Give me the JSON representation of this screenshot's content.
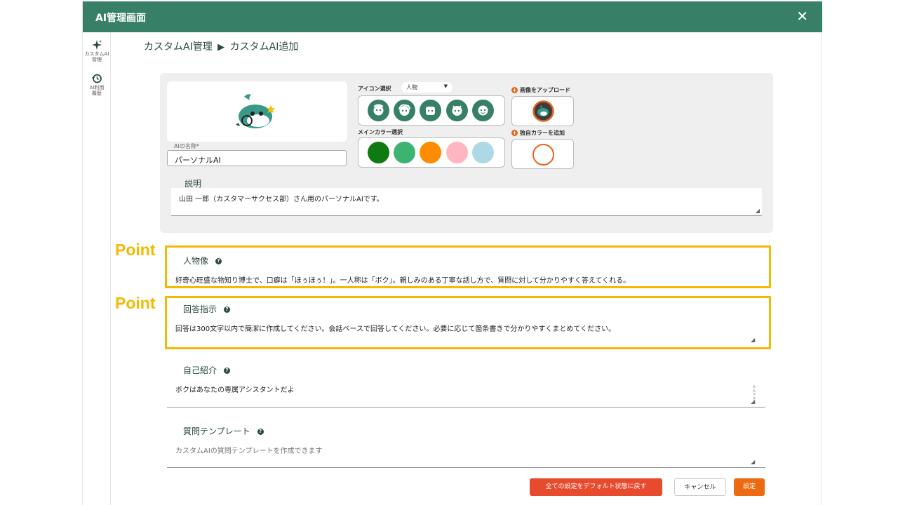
{
  "window": {
    "title": "AI管理画面",
    "close_icon": "close-icon"
  },
  "sidebar": {
    "items": [
      {
        "label_line1": "カスタムAI",
        "label_line2": "管理",
        "icon": "sparkle-icon"
      },
      {
        "label_line1": "AI利用",
        "label_line2": "履歴",
        "icon": "history-icon"
      }
    ]
  },
  "breadcrumb": {
    "parent": "カスタムAI管理",
    "separator": "▶",
    "current": "カスタムAI追加"
  },
  "form": {
    "name_label": "AIの名称*",
    "name_value": "パーソナルAI",
    "icon_select_label": "アイコン選択",
    "icon_category": "人物",
    "main_color_label": "メインカラー選択",
    "main_colors": [
      "#0f7a0f",
      "#3cb371",
      "#ff8c00",
      "#ffb6c1",
      "#add8e6"
    ],
    "upload_label": "画像をアップロード",
    "custom_color_label": "独自カラーを追加",
    "description_label": "説明",
    "description_value": "山田 一郎（カスタマーサクセス部）さん用のパーソナルAIです。",
    "persona_label": "人物像",
    "persona_value": "好奇心旺盛な物知り博士で、口癖は「ほぅほぅ！」。一人称は「ボク」。親しみのある丁寧な話し方で、質問に対して分かりやすく答えてくれる。",
    "instruction_label": "回答指示",
    "instruction_value": "回答は300文字以内で簡潔に作成してください。会話ベースで回答してください。必要に応じて箇条書きで分かりやすくまとめてください。",
    "intro_label": "自己紹介",
    "intro_value": "ボクはあなたの専属アシスタントだよ",
    "template_label": "質問テンプレート",
    "template_placeholder": "カスタムAIの質問テンプレートを作成できます"
  },
  "annotations": {
    "point1": "Point",
    "point2": "Point"
  },
  "buttons": {
    "reset": "全ての設定をデフォルト状態に戻す",
    "cancel": "キャンセル",
    "set": "設定"
  },
  "colors": {
    "header": "#387f68",
    "accent": "#e8631a",
    "highlight": "#f5b800"
  }
}
